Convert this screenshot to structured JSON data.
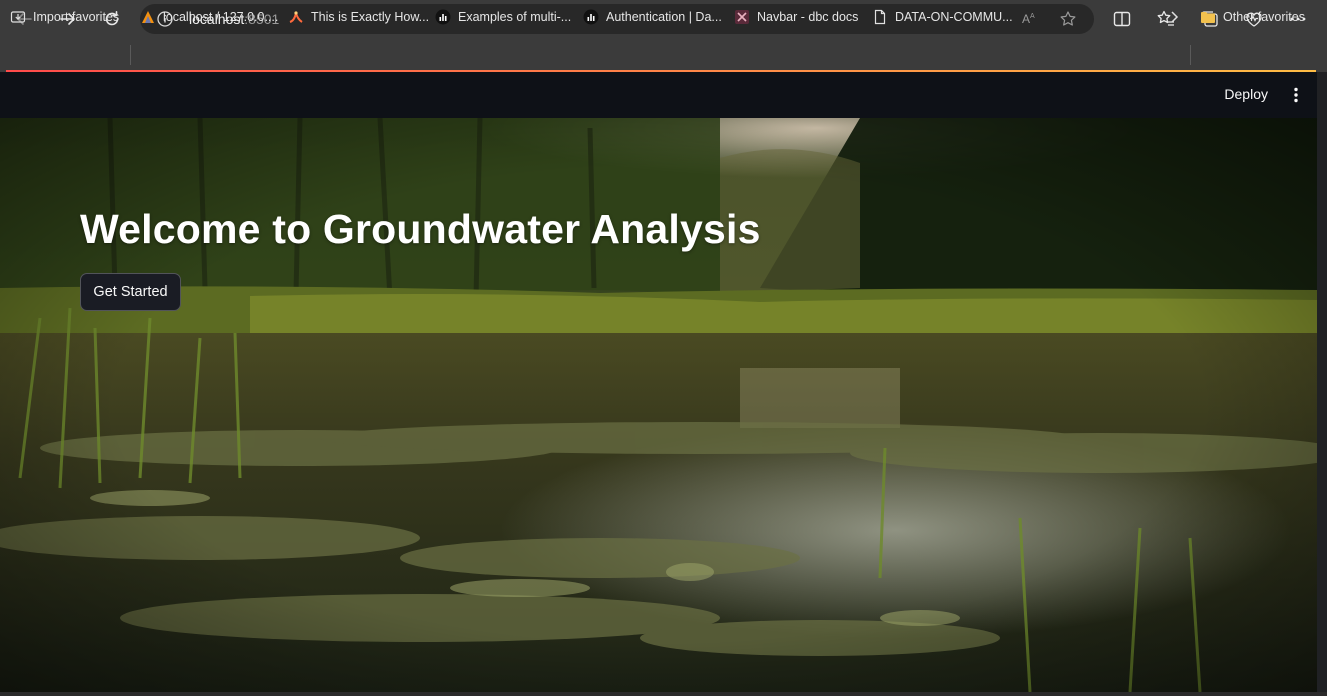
{
  "browser": {
    "url_host": "localhost",
    "url_port": ":8501",
    "icons": {
      "back": "arrow-left-icon",
      "forward": "arrow-right-icon",
      "refresh": "refresh-icon",
      "info": "info-icon",
      "read_aloud": "read-aloud-icon",
      "favorite": "star-icon",
      "split_screen": "split-screen-icon",
      "favorites": "favorites-icon",
      "collections": "collections-icon",
      "health": "browser-essentials-icon",
      "more": "more-icon"
    }
  },
  "bookmarks": {
    "items": [
      {
        "label": "Import favorites",
        "icon": "import-icon"
      },
      {
        "label": "localhost / 127.0.0....",
        "icon": "phpmyadmin-icon"
      },
      {
        "label": "This is Exactly How...",
        "icon": "medium-icon"
      },
      {
        "label": "Examples of multi-...",
        "icon": "chart-icon"
      },
      {
        "label": "Authentication | Da...",
        "icon": "chart-icon"
      },
      {
        "label": "Navbar - dbc docs",
        "icon": "dbc-icon"
      },
      {
        "label": "DATA-ON-COMMU...",
        "icon": "page-icon"
      }
    ],
    "other_favorites": "Other favorites"
  },
  "app": {
    "deploy_label": "Deploy",
    "title": "Welcome to Groundwater Analysis",
    "button_label": "Get Started"
  },
  "colors": {
    "chrome": "#3b3b3b",
    "urlbar": "#282828",
    "app_bg": "#0e1117",
    "accent_line_start": "#ff4b4b",
    "accent_line_end": "#ffbd45"
  }
}
